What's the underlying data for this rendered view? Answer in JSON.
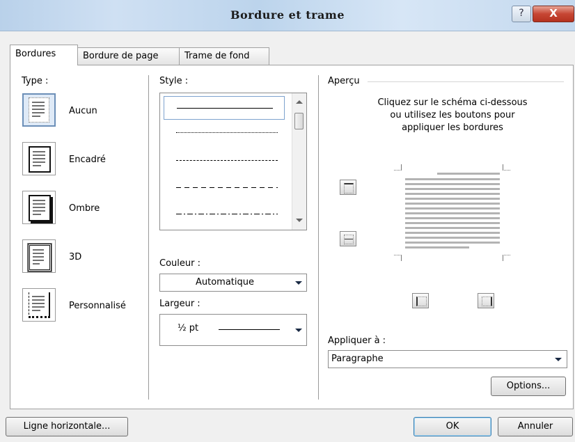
{
  "window": {
    "title": "Bordure et trame",
    "help_label": "?",
    "close_label": "X"
  },
  "tabs": [
    {
      "label": "Bordures"
    },
    {
      "label": "Bordure de page"
    },
    {
      "label": "Trame de fond"
    }
  ],
  "type_section": {
    "label": "Type :",
    "items": [
      {
        "label": "Aucun",
        "selected": true
      },
      {
        "label": "Encadré",
        "selected": false
      },
      {
        "label": "Ombre",
        "selected": false
      },
      {
        "label": "3D",
        "selected": false
      },
      {
        "label": "Personnalisé",
        "selected": false
      }
    ]
  },
  "style_section": {
    "label": "Style :",
    "styles": [
      "solid",
      "dotted",
      "dashed-fine",
      "dashed",
      "dash-dot"
    ]
  },
  "color_section": {
    "label": "Couleur :",
    "value": "Automatique"
  },
  "width_section": {
    "label": "Largeur :",
    "value": "½ pt"
  },
  "preview_section": {
    "label": "Aperçu",
    "instruction_lines": [
      "Cliquez sur le schéma ci-dessous",
      "ou utilisez les boutons pour",
      "appliquer les bordures"
    ]
  },
  "apply_section": {
    "label": "Appliquer à :",
    "value": "Paragraphe"
  },
  "buttons": {
    "options": "Options...",
    "horizontal_line": "Ligne horizontale...",
    "ok": "OK",
    "cancel": "Annuler"
  },
  "colors": {
    "title_bar": "#c5d9ef",
    "close_button": "#c64634",
    "selection": "#dfeaf7"
  }
}
